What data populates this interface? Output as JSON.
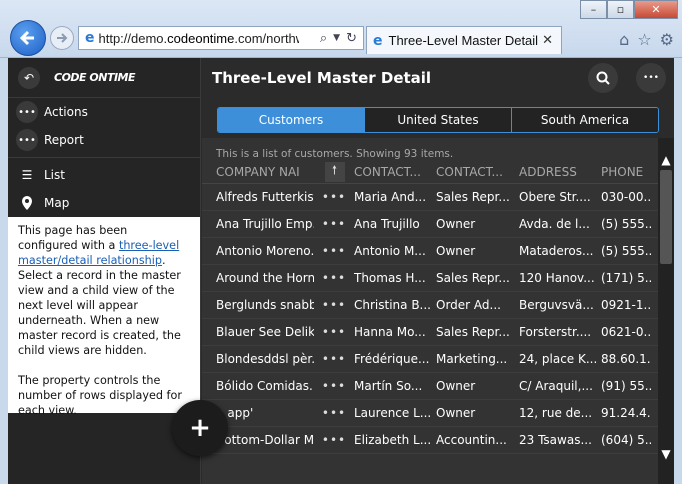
{
  "browser": {
    "url_prefix": "http://demo.",
    "url_host": "codeontime",
    "url_rest": ".com/northw",
    "tab_title": "Three-Level Master Detail"
  },
  "sidebar": {
    "logo": "CODE ONTIME",
    "items": [
      {
        "label": "Actions",
        "icon": "more-icon"
      },
      {
        "label": "Report",
        "icon": "more-icon"
      },
      {
        "label": "List",
        "icon": "list-icon"
      },
      {
        "label": "Map",
        "icon": "map-pin-icon"
      }
    ],
    "description": {
      "part1": "This page has been configured with a ",
      "link": "three-level master/detail relationship",
      "part2": ". Select a record in the master view and a child view of the next level will appear underneath. When a new master record is created, the child views are hidden.",
      "part3": "The property controls the number of rows displayed for each view."
    }
  },
  "header": {
    "title": "Three-Level Master Detail"
  },
  "tabs": [
    {
      "label": "Customers",
      "active": true
    },
    {
      "label": "United States",
      "active": false
    },
    {
      "label": "South America",
      "active": false
    }
  ],
  "grid": {
    "info": "This is a list of customers. Showing 93 items.",
    "columns": [
      "COMPANY NAI",
      "CONTACT...",
      "CONTACT...",
      "ADDRESS",
      "PHONE"
    ],
    "rows": [
      [
        "Alfreds Futterkiste",
        "Maria And...",
        "Sales Repr...",
        "Obere Str....",
        "030-00..."
      ],
      [
        "Ana Trujillo Emp...",
        "Ana Trujillo",
        "Owner",
        "Avda. de l...",
        "(5) 555..."
      ],
      [
        "Antonio Moreno...",
        "Antonio M...",
        "Owner",
        "Mataderos...",
        "(5) 555..."
      ],
      [
        "Around the Horn",
        "Thomas H...",
        "Sales Repr...",
        "120 Hanov...",
        "(171) 5..."
      ],
      [
        "Berglunds snabb...",
        "Christina B...",
        "Order Ad...",
        "Berguvsvä...",
        "0921-1..."
      ],
      [
        "Blauer See Delik...",
        "Hanna Mo...",
        "Sales Repr...",
        "Forsterstr....",
        "0621-0..."
      ],
      [
        "Blondesddsl pèr...",
        "Frédérique...",
        "Marketing...",
        "24, place K...",
        "88.60.1..."
      ],
      [
        "Bólido Comidas...",
        "Martín So...",
        "Owner",
        "C/ Araquil,...",
        "(91) 55..."
      ],
      [
        "n app'",
        "Laurence L...",
        "Owner",
        "12, rue de...",
        "91.24.4..."
      ],
      [
        "Bottom-Dollar M...",
        "Elizabeth L...",
        "Accountin...",
        "23 Tsawas...",
        "(604) 5..."
      ]
    ]
  },
  "colors": {
    "accent": "#3d8fd9",
    "app_bg": "#2b2b2b"
  }
}
